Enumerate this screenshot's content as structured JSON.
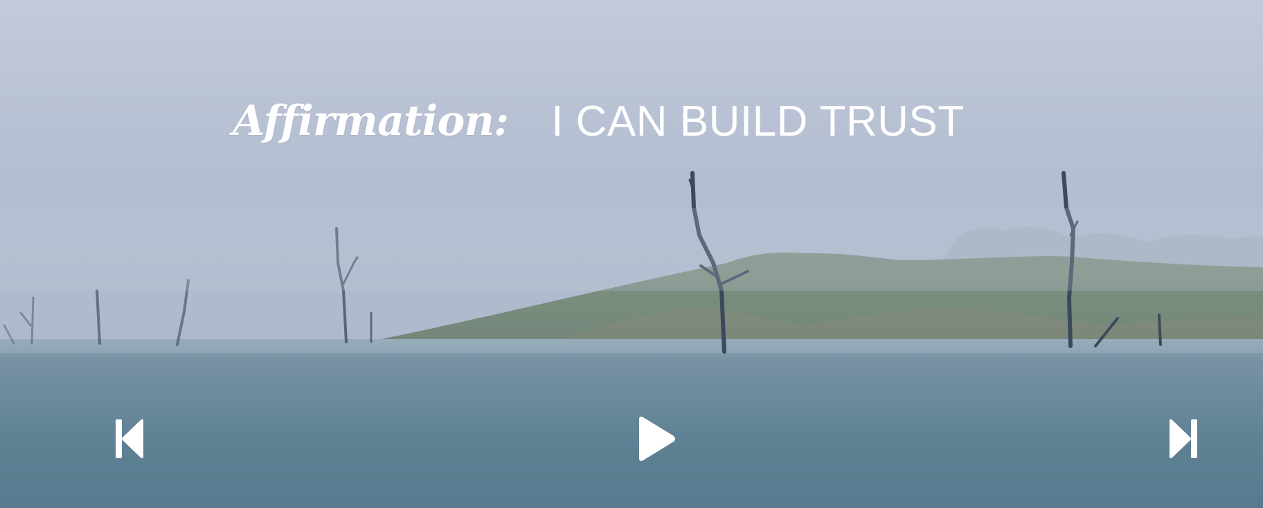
{
  "affirmation": {
    "label": "Affirmation:",
    "text": "I CAN BUILD TRUST"
  },
  "controls": {
    "previous_icon": "skip-previous-icon",
    "play_icon": "play-icon",
    "next_icon": "skip-next-icon"
  },
  "colors": {
    "text": "#ffffff",
    "sky": "#bcc4d4",
    "water": "#5c7f93"
  }
}
